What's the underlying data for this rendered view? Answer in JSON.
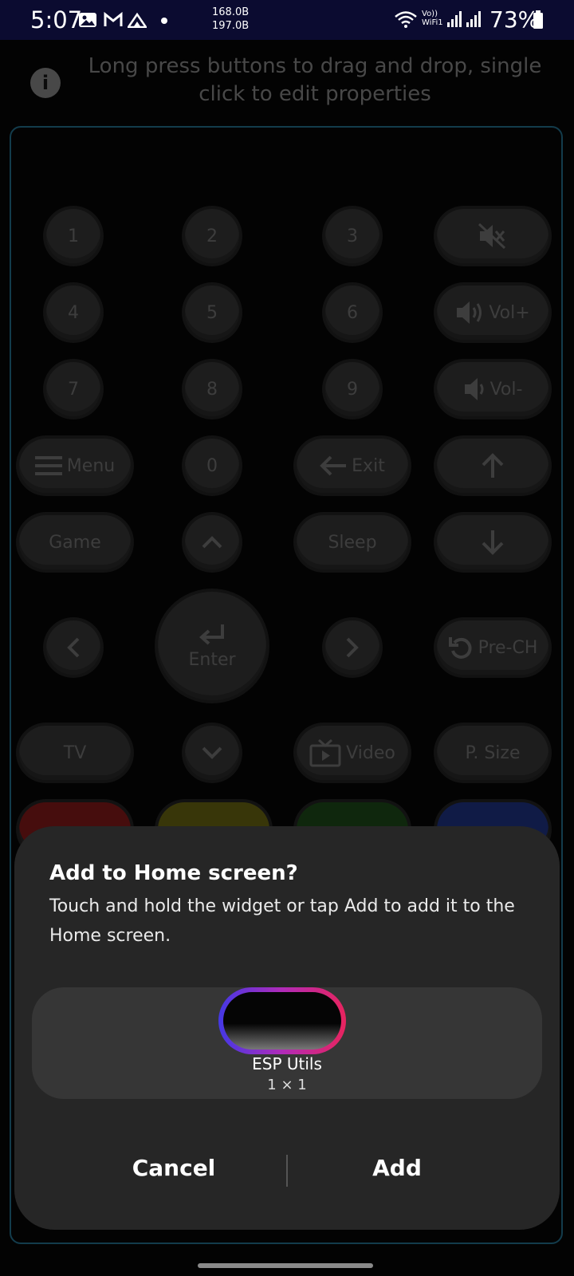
{
  "status_bar": {
    "time": "5:07",
    "net_speed_up": "168.0B",
    "net_speed_down": "197.0B",
    "volte_line1": "Vo))",
    "volte_line2": "WiFi1",
    "battery": "73%",
    "icons": [
      "gallery-icon",
      "gmail-icon",
      "home-signal-icon",
      "dot-icon",
      "wifi-icon",
      "signal-icon",
      "battery-icon"
    ]
  },
  "app": {
    "hint": "Long press buttons to drag and drop, single click to edit properties",
    "remote": {
      "numbers": [
        "1",
        "2",
        "3",
        "4",
        "5",
        "6",
        "7",
        "8",
        "9",
        "0"
      ],
      "vol_up": "Vol+",
      "vol_down": "Vol-",
      "menu": "Menu",
      "exit": "Exit",
      "game": "Game",
      "sleep": "Sleep",
      "enter": "Enter",
      "pre_ch": "Pre-CH",
      "tv": "TV",
      "video": "Video",
      "p_size": "P. Size"
    }
  },
  "dialog": {
    "title": "Add to Home screen?",
    "message": "Touch and hold the widget or tap Add to add it to the Home screen.",
    "widget_name": "ESP Utils",
    "widget_size": "1 × 1",
    "cancel": "Cancel",
    "add": "Add"
  },
  "colors": {
    "status_bar_bg": "#0b0b30",
    "panel_border": "#1e5c75",
    "dialog_bg": "#262626",
    "widget_gradient": [
      "#4438e6",
      "#b02bb8",
      "#e8245e"
    ]
  }
}
